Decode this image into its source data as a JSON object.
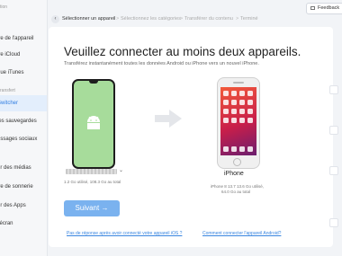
{
  "sidebar": {
    "items": [
      {
        "label": "ire de l'appareil"
      },
      {
        "label": "ire iCloud"
      },
      {
        "label": "que iTunes"
      },
      {
        "label": "Switcher"
      },
      {
        "label": "les sauvegardes"
      },
      {
        "label": "essages sociaux"
      },
      {
        "label": "er des médias"
      },
      {
        "label": "ire de sonnerie"
      },
      {
        "label": "er des Apps"
      },
      {
        "label": "l'écran"
      }
    ],
    "section_top": "tion",
    "section_transfer": "ransfert"
  },
  "header": {
    "back_icon": "chevron-left-icon",
    "breadcrumb": [
      {
        "label": "Sélectionner un appareil"
      },
      {
        "label": "Sélectionnez les catégories"
      },
      {
        "label": "Transférer du contenu"
      },
      {
        "label": "Terminé"
      }
    ],
    "separator": ">",
    "feedback_label": "Feedback"
  },
  "main": {
    "title": "Veuillez connecter au moins deux appareils.",
    "subtitle": "Transférez instantanément toutes les données Android ou iPhone vers un nouvel iPhone.",
    "source": {
      "storage": "1.2 Go utilisé, 108.3 Go au total",
      "dropdown_icon": "chevron-down-icon"
    },
    "target": {
      "name": "iPhone",
      "version": "iPhone 8 13.7 13.6 Go utilisé,",
      "storage": "64.0 Go au total"
    },
    "next_button": "Suivant →",
    "link_ios": "Pas de réponse après avoir connecté votre appareil iOS ?",
    "link_android": "Comment connecter l'appareil Android?"
  },
  "colors": {
    "accent": "#2f7de1",
    "button": "#7ab2ef",
    "android_green": "#a7dc9b"
  }
}
